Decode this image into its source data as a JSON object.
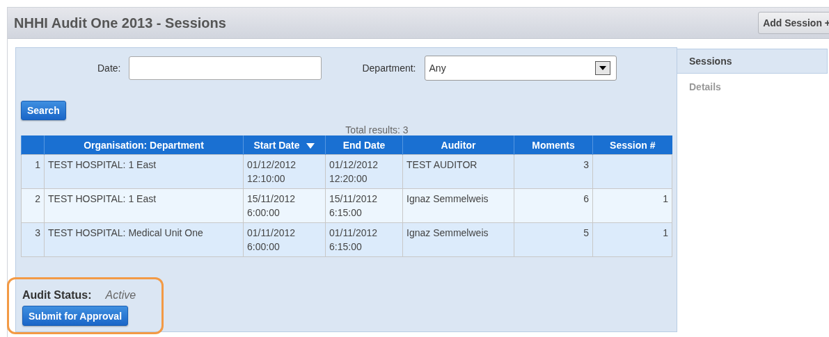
{
  "header": {
    "title": "NHHI Audit One 2013 - Sessions",
    "add_button": "Add Session +"
  },
  "filters": {
    "date_label": "Date:",
    "department_label": "Department:",
    "department_value": "Any",
    "search_button": "Search"
  },
  "total_results": "Total results: 3",
  "table": {
    "columns": [
      {
        "sorted": false
      },
      {
        "label": "Organisation: Department",
        "sorted": false
      },
      {
        "label": "Start Date",
        "sorted": true
      },
      {
        "label": "End Date",
        "sorted": false
      },
      {
        "label": "Auditor",
        "sorted": false
      },
      {
        "label": "Moments",
        "sorted": false
      },
      {
        "label": "Session #",
        "sorted": false
      }
    ],
    "rows": [
      {
        "cells": [
          "1",
          "TEST HOSPITAL: 1 East",
          "01/12/2012 12:10:00",
          "01/12/2012 12:20:00",
          "TEST AUDITOR",
          "3",
          ""
        ]
      },
      {
        "cells": [
          "2",
          "TEST HOSPITAL: 1 East",
          "15/11/2012 6:00:00",
          "15/11/2012 6:15:00",
          "Ignaz Semmelweis",
          "6",
          "1"
        ]
      },
      {
        "cells": [
          "3",
          "TEST HOSPITAL: Medical Unit One",
          "01/11/2012 6:00:00",
          "01/11/2012 6:15:00",
          "Ignaz Semmelweis",
          "5",
          "1"
        ]
      }
    ]
  },
  "audit_status": {
    "label": "Audit Status:",
    "value": "Active",
    "button": "Submit for Approval",
    "highlighted": true
  },
  "side_tabs": [
    {
      "label": "Sessions",
      "selected": true
    },
    {
      "label": "Details",
      "selected": false
    }
  ]
}
